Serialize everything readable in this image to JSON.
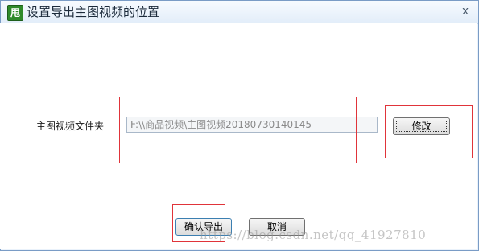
{
  "window": {
    "title": "设置导出主图视频的位置",
    "app_icon_text": "甩",
    "close_glyph": "x"
  },
  "form": {
    "field_label": "主图视频文件夹",
    "path_value": "F:\\\\商品视频\\主图视频20180730140145"
  },
  "buttons": {
    "modify": "修改",
    "confirm": "确认导出",
    "cancel": "取消"
  },
  "watermark": "https://blog.csdn.net/qq_41927810",
  "colors": {
    "annotation_red": "#e0343a",
    "title_bar": "#e2edf9",
    "app_icon": "#2f8a2a"
  }
}
